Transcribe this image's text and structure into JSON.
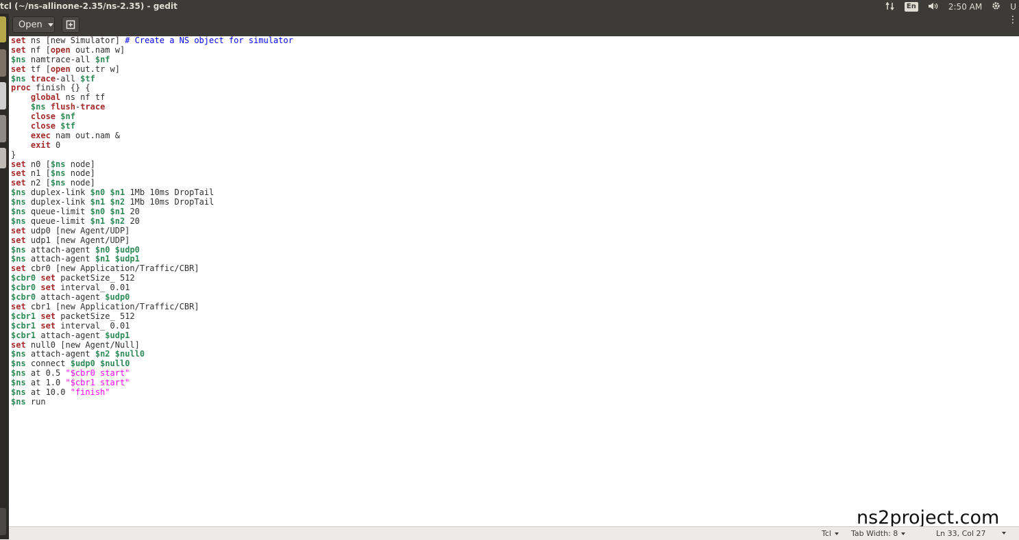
{
  "window": {
    "title": "tcl (~/ns-allinone-2.35/ns-2.35) - gedit"
  },
  "panel": {
    "keyboard_layout": "En",
    "clock": "2:50 AM",
    "user_partial": "U"
  },
  "toolbar": {
    "open_label": "Open"
  },
  "editor": {
    "lines": [
      [
        {
          "t": "set",
          "c": "kw"
        },
        {
          "t": " ns [new Simulator] "
        },
        {
          "t": "# Create a NS object for simulator",
          "c": "cm"
        }
      ],
      [
        {
          "t": "set",
          "c": "kw"
        },
        {
          "t": " nf ["
        },
        {
          "t": "open",
          "c": "kw"
        },
        {
          "t": " out.nam w]"
        }
      ],
      [
        {
          "t": "$ns",
          "c": "var"
        },
        {
          "t": " namtrace-all "
        },
        {
          "t": "$nf",
          "c": "var"
        }
      ],
      [
        {
          "t": "set",
          "c": "kw"
        },
        {
          "t": " tf ["
        },
        {
          "t": "open",
          "c": "kw"
        },
        {
          "t": " out.tr w]"
        }
      ],
      [
        {
          "t": "$ns",
          "c": "var"
        },
        {
          "t": " "
        },
        {
          "t": "trace",
          "c": "kw"
        },
        {
          "t": "-all "
        },
        {
          "t": "$tf",
          "c": "var"
        }
      ],
      [
        {
          "t": "proc",
          "c": "kw"
        },
        {
          "t": " finish {} {"
        }
      ],
      [
        {
          "t": "    "
        },
        {
          "t": "global",
          "c": "kw"
        },
        {
          "t": " ns nf tf"
        }
      ],
      [
        {
          "t": "    "
        },
        {
          "t": "$ns",
          "c": "var"
        },
        {
          "t": " "
        },
        {
          "t": "flush",
          "c": "kw"
        },
        {
          "t": "-"
        },
        {
          "t": "trace",
          "c": "kw"
        }
      ],
      [
        {
          "t": "    "
        },
        {
          "t": "close",
          "c": "kw"
        },
        {
          "t": " "
        },
        {
          "t": "$nf",
          "c": "var"
        }
      ],
      [
        {
          "t": "    "
        },
        {
          "t": "close",
          "c": "kw"
        },
        {
          "t": " "
        },
        {
          "t": "$tf",
          "c": "var"
        }
      ],
      [
        {
          "t": "    "
        },
        {
          "t": "exec",
          "c": "kw"
        },
        {
          "t": " nam out.nam &"
        }
      ],
      [
        {
          "t": "    "
        },
        {
          "t": "exit",
          "c": "kw"
        },
        {
          "t": " 0"
        }
      ],
      [
        {
          "t": "}"
        }
      ],
      [
        {
          "t": "set",
          "c": "kw"
        },
        {
          "t": " n0 ["
        },
        {
          "t": "$ns",
          "c": "var"
        },
        {
          "t": " node]"
        }
      ],
      [
        {
          "t": "set",
          "c": "kw"
        },
        {
          "t": " n1 ["
        },
        {
          "t": "$ns",
          "c": "var"
        },
        {
          "t": " node]"
        }
      ],
      [
        {
          "t": "set",
          "c": "kw"
        },
        {
          "t": " n2 ["
        },
        {
          "t": "$ns",
          "c": "var"
        },
        {
          "t": " node]"
        }
      ],
      [
        {
          "t": "$ns",
          "c": "var"
        },
        {
          "t": " duplex-link "
        },
        {
          "t": "$n0",
          "c": "var"
        },
        {
          "t": " "
        },
        {
          "t": "$n1",
          "c": "var"
        },
        {
          "t": " 1Mb 10ms DropTail"
        }
      ],
      [
        {
          "t": "$ns",
          "c": "var"
        },
        {
          "t": " duplex-link "
        },
        {
          "t": "$n1",
          "c": "var"
        },
        {
          "t": " "
        },
        {
          "t": "$n2",
          "c": "var"
        },
        {
          "t": " 1Mb 10ms DropTail"
        }
      ],
      [
        {
          "t": "$ns",
          "c": "var"
        },
        {
          "t": " queue-limit "
        },
        {
          "t": "$n0",
          "c": "var"
        },
        {
          "t": " "
        },
        {
          "t": "$n1",
          "c": "var"
        },
        {
          "t": " 20"
        }
      ],
      [
        {
          "t": "$ns",
          "c": "var"
        },
        {
          "t": " queue-limit "
        },
        {
          "t": "$n1",
          "c": "var"
        },
        {
          "t": " "
        },
        {
          "t": "$n2",
          "c": "var"
        },
        {
          "t": " 20"
        }
      ],
      [
        {
          "t": "set",
          "c": "kw"
        },
        {
          "t": " udp0 [new Agent/UDP]"
        }
      ],
      [
        {
          "t": "set",
          "c": "kw"
        },
        {
          "t": " udp1 [new Agent/UDP]"
        }
      ],
      [
        {
          "t": "$ns",
          "c": "var"
        },
        {
          "t": " attach-agent "
        },
        {
          "t": "$n0",
          "c": "var"
        },
        {
          "t": " "
        },
        {
          "t": "$udp0",
          "c": "var"
        }
      ],
      [
        {
          "t": "$ns",
          "c": "var"
        },
        {
          "t": " attach-agent "
        },
        {
          "t": "$n1",
          "c": "var"
        },
        {
          "t": " "
        },
        {
          "t": "$udp1",
          "c": "var"
        }
      ],
      [
        {
          "t": "set",
          "c": "kw"
        },
        {
          "t": " cbr0 [new Application/Traffic/CBR]"
        }
      ],
      [
        {
          "t": "$cbr0",
          "c": "var"
        },
        {
          "t": " "
        },
        {
          "t": "set",
          "c": "kw"
        },
        {
          "t": " packetSize_ 512"
        }
      ],
      [
        {
          "t": "$cbr0",
          "c": "var"
        },
        {
          "t": " "
        },
        {
          "t": "set",
          "c": "kw"
        },
        {
          "t": " interval_ 0.01"
        }
      ],
      [
        {
          "t": "$cbr0",
          "c": "var"
        },
        {
          "t": " attach-agent "
        },
        {
          "t": "$udp0",
          "c": "var"
        }
      ],
      [
        {
          "t": "set",
          "c": "kw"
        },
        {
          "t": " cbr1 [new Application/Traffic/CBR]"
        }
      ],
      [
        {
          "t": "$cbr1",
          "c": "var"
        },
        {
          "t": " "
        },
        {
          "t": "set",
          "c": "kw"
        },
        {
          "t": " packetSize_ 512"
        }
      ],
      [
        {
          "t": "$cbr1",
          "c": "var"
        },
        {
          "t": " "
        },
        {
          "t": "set",
          "c": "kw"
        },
        {
          "t": " interval_ 0.01"
        }
      ],
      [
        {
          "t": "$cbr1",
          "c": "var"
        },
        {
          "t": " attach-agent "
        },
        {
          "t": "$udp1",
          "c": "var"
        }
      ],
      [
        {
          "t": "set",
          "c": "kw"
        },
        {
          "t": " null0 [new Agent/Null]"
        }
      ],
      [
        {
          "t": "$ns",
          "c": "var"
        },
        {
          "t": " attach-agent "
        },
        {
          "t": "$n2",
          "c": "var"
        },
        {
          "t": " "
        },
        {
          "t": "$null0",
          "c": "var"
        }
      ],
      [
        {
          "t": "$ns",
          "c": "var"
        },
        {
          "t": " connect "
        },
        {
          "t": "$udp0",
          "c": "var"
        },
        {
          "t": " "
        },
        {
          "t": "$null0",
          "c": "var"
        }
      ],
      [
        {
          "t": "$ns",
          "c": "var"
        },
        {
          "t": " at 0.5 "
        },
        {
          "t": "\"$cbr0 start\"",
          "c": "str"
        }
      ],
      [
        {
          "t": "$ns",
          "c": "var"
        },
        {
          "t": " at 1.0 "
        },
        {
          "t": "\"$cbr1 start\"",
          "c": "str"
        }
      ],
      [
        {
          "t": "$ns",
          "c": "var"
        },
        {
          "t": " at 10.0 "
        },
        {
          "t": "\"finish\"",
          "c": "str"
        }
      ],
      [
        {
          "t": "$ns",
          "c": "var"
        },
        {
          "t": " run"
        }
      ]
    ]
  },
  "watermark": "ns2project.com",
  "statusbar": {
    "language": "Tcl",
    "tab_width": "Tab Width: 8",
    "position": "Ln 33, Col 27"
  }
}
